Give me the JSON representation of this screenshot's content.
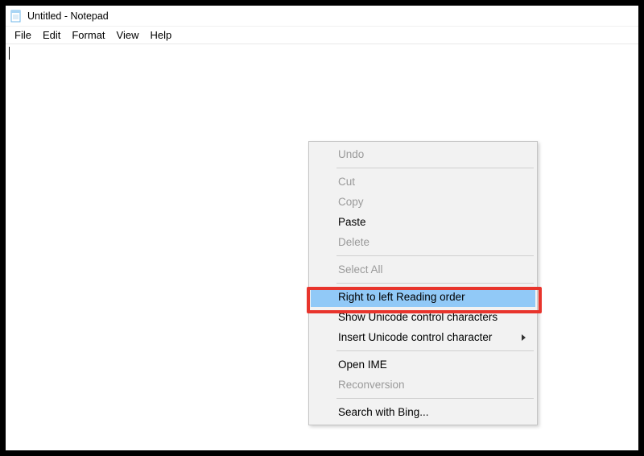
{
  "window": {
    "title": "Untitled - Notepad"
  },
  "menubar": {
    "file": "File",
    "edit": "Edit",
    "format": "Format",
    "view": "View",
    "help": "Help"
  },
  "context_menu": {
    "undo": "Undo",
    "cut": "Cut",
    "copy": "Copy",
    "paste": "Paste",
    "delete": "Delete",
    "select_all": "Select All",
    "rtl_reading_order": "Right to left Reading order",
    "show_unicode_ctrl": "Show Unicode control characters",
    "insert_unicode_ctrl": "Insert Unicode control character",
    "open_ime": "Open IME",
    "reconversion": "Reconversion",
    "search_bing": "Search with Bing..."
  }
}
